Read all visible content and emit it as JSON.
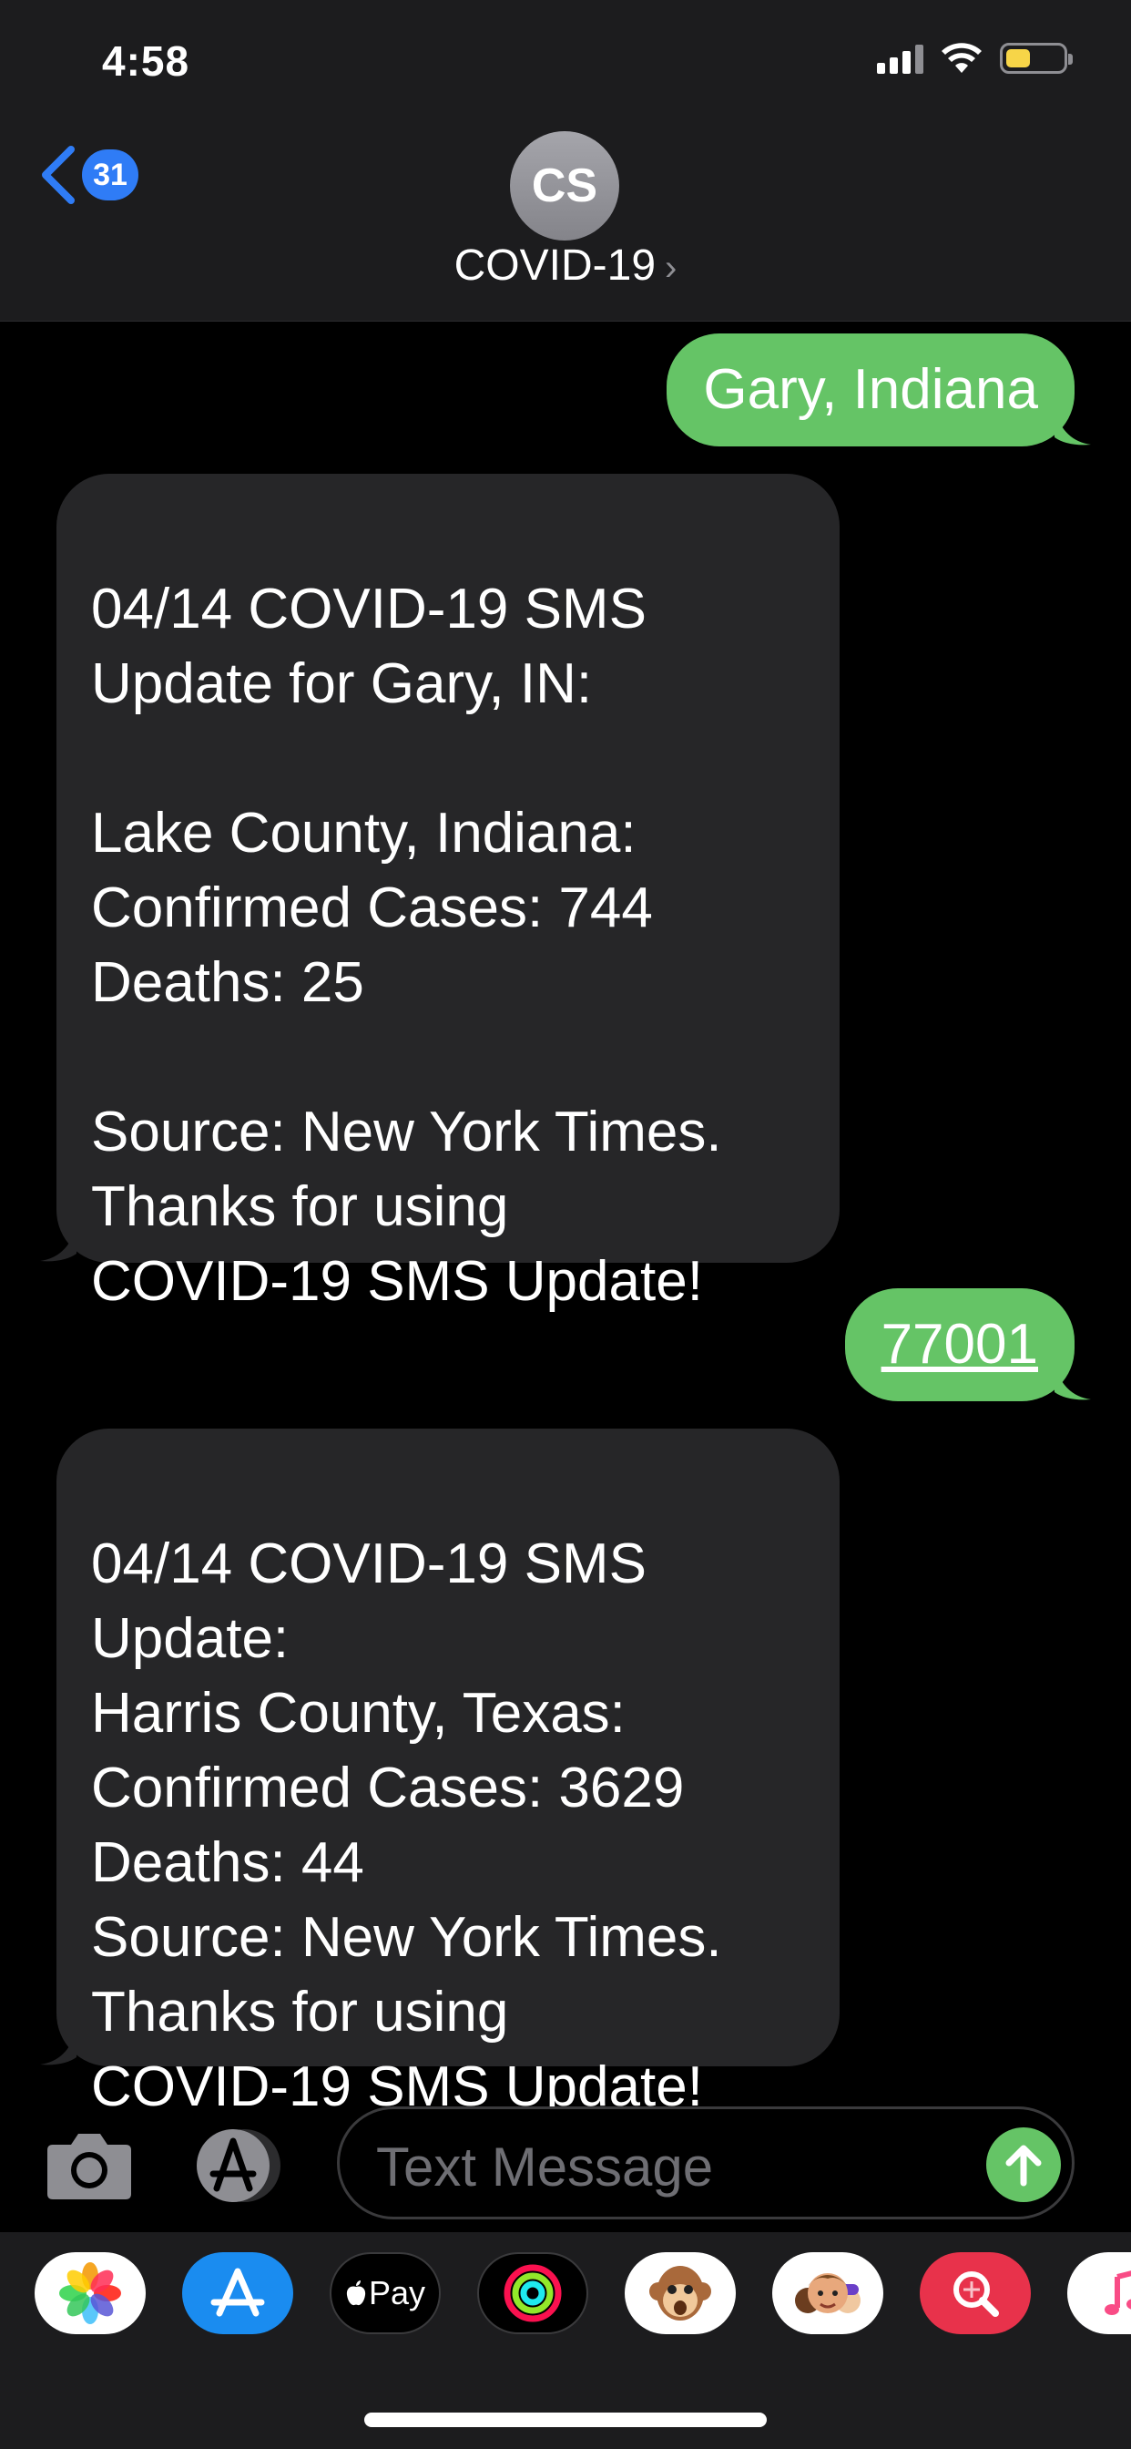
{
  "status_bar": {
    "time": "4:58",
    "signal_icon": "cellular-signal-icon",
    "wifi_icon": "wifi-icon",
    "battery_icon": "battery-low-icon"
  },
  "header": {
    "back_badge_count": "31",
    "avatar_initials": "CS",
    "contact_name": "COVID-19",
    "contact_chevron": "›"
  },
  "messages": [
    {
      "direction": "outgoing",
      "text": "Gary, Indiana"
    },
    {
      "direction": "incoming",
      "text": "04/14 COVID-19 SMS\nUpdate for Gary, IN:\n\nLake County, Indiana:\nConfirmed Cases: 744\nDeaths: 25\n\nSource: New York Times.\nThanks for using\nCOVID-19 SMS Update!"
    },
    {
      "direction": "outgoing",
      "text": "77001"
    },
    {
      "direction": "incoming",
      "text": "04/14 COVID-19 SMS\nUpdate:\nHarris County, Texas:\nConfirmed Cases: 3629\nDeaths: 44\nSource: New York Times.\nThanks for using\nCOVID-19 SMS Update!"
    }
  ],
  "compose": {
    "placeholder": "Text Message"
  },
  "app_drawer": {
    "apps": [
      "photos-icon",
      "app-store-icon",
      "apple-pay-icon",
      "activity-icon",
      "animoji-icon",
      "memoji-icon",
      "image-search-icon",
      "music-icon"
    ],
    "apple_pay_label": "Pay"
  },
  "colors": {
    "outgoing_bubble": "#65c466",
    "incoming_bubble": "#262628",
    "accent_blue": "#2f7cf6"
  }
}
